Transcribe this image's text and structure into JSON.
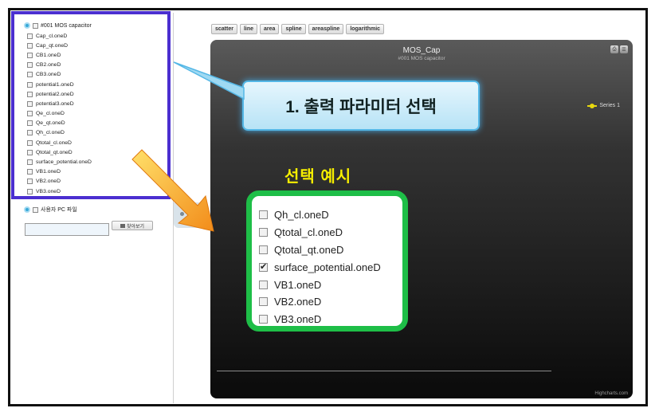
{
  "tree": {
    "root": "#001 MOS capacitor",
    "items": [
      "Cap_cl.oneD",
      "Cap_qt.oneD",
      "CB1.oneD",
      "CB2.oneD",
      "CB3.oneD",
      "potential1.oneD",
      "potential2.oneD",
      "potential3.oneD",
      "Qe_cl.oneD",
      "Qe_qt.oneD",
      "Qh_cl.oneD",
      "Qtotal_cl.oneD",
      "Qtotal_qt.oneD",
      "surface_potential.oneD",
      "VB1.oneD",
      "VB2.oneD",
      "VB3.oneD"
    ]
  },
  "local_file": {
    "label": "사용자 PC 파일",
    "browse_label": "찾아보기",
    "value": ""
  },
  "toolbar": {
    "buttons": [
      "scatter",
      "line",
      "area",
      "spline",
      "areaspline",
      "logarithmic"
    ]
  },
  "chart_data": {
    "type": "line",
    "title": "MOS_Cap",
    "subtitle": "#001 MOS capacitor",
    "series": [
      {
        "name": "Series 1",
        "values": []
      }
    ],
    "legend_position": "right",
    "credits": "Highcharts.com",
    "colors": {
      "series": "#e7d80f",
      "background": "#2a2a2a"
    }
  },
  "callout": {
    "text": "1. 출력 파라미터 선택"
  },
  "example": {
    "title": "선택 예시",
    "items": [
      {
        "label": "Qh_cl.oneD",
        "checked": false
      },
      {
        "label": "Qtotal_cl.oneD",
        "checked": false
      },
      {
        "label": "Qtotal_qt.oneD",
        "checked": false
      },
      {
        "label": "surface_potential.oneD",
        "checked": true
      },
      {
        "label": "VB1.oneD",
        "checked": false
      },
      {
        "label": "VB2.oneD",
        "checked": false
      },
      {
        "label": "VB3.oneD",
        "checked": false
      }
    ]
  },
  "colors": {
    "highlight_box": "#4b2fd0",
    "example_box": "#1ebe47",
    "arrow": "#f7921e",
    "callout_glow": "#46a7e0",
    "example_title": "#f6ee00"
  }
}
